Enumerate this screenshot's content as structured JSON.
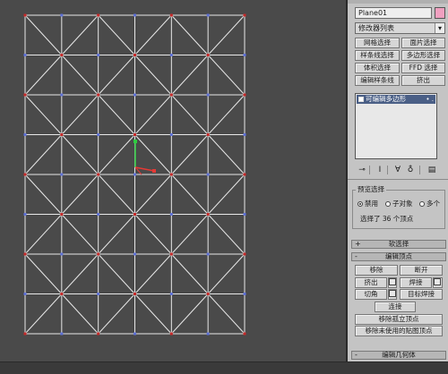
{
  "object_name": "Plane01",
  "colors": {
    "viewport_bg": "#4a4a4a",
    "wire": "#e8e8e8",
    "vertex_red": "#c62828",
    "vertex_blue": "#5c6fd6",
    "swatch": "#f0a0c0",
    "stack_selected": "#4a5f86"
  },
  "modifier_list": {
    "label": "修改器列表",
    "arrow_icon": "chevron-down-icon"
  },
  "modifier_buttons": [
    "网格选择",
    "面片选择",
    "样条线选择",
    "多边形选择",
    "体积选择",
    "FFD 选择",
    "编辑样条线",
    "挤出"
  ],
  "stack": {
    "selected_item": "可编辑多边形",
    "dots": "• ."
  },
  "tools": [
    "pin-stack-icon",
    "show-end-result-icon",
    "make-unique-icon",
    "remove-modifier-icon",
    "configure-sets-icon"
  ],
  "preview_selection": {
    "title": "预览选择",
    "options": [
      "禁用",
      "子对象",
      "多个"
    ],
    "selected_index": 0,
    "status_text": "选择了 36 个顶点"
  },
  "rollouts": {
    "soft_selection": {
      "sign": "+",
      "label": "软选择"
    },
    "edit_vertices": {
      "sign": "-",
      "label": "编辑顶点"
    },
    "edit_geometry": {
      "sign": "-",
      "label": "编辑几何体"
    }
  },
  "edit_vertex_buttons": {
    "remove": "移除",
    "break": "断开",
    "extrude": "挤出",
    "weld": "焊接",
    "chamfer": "切角",
    "target_weld": "目标焊接",
    "connect": "连接",
    "remove_isolated": "移除孤立顶点",
    "remove_unused_map": "移除未使用的贴图顶点"
  },
  "mesh": {
    "cols": 6,
    "rows": 8
  }
}
